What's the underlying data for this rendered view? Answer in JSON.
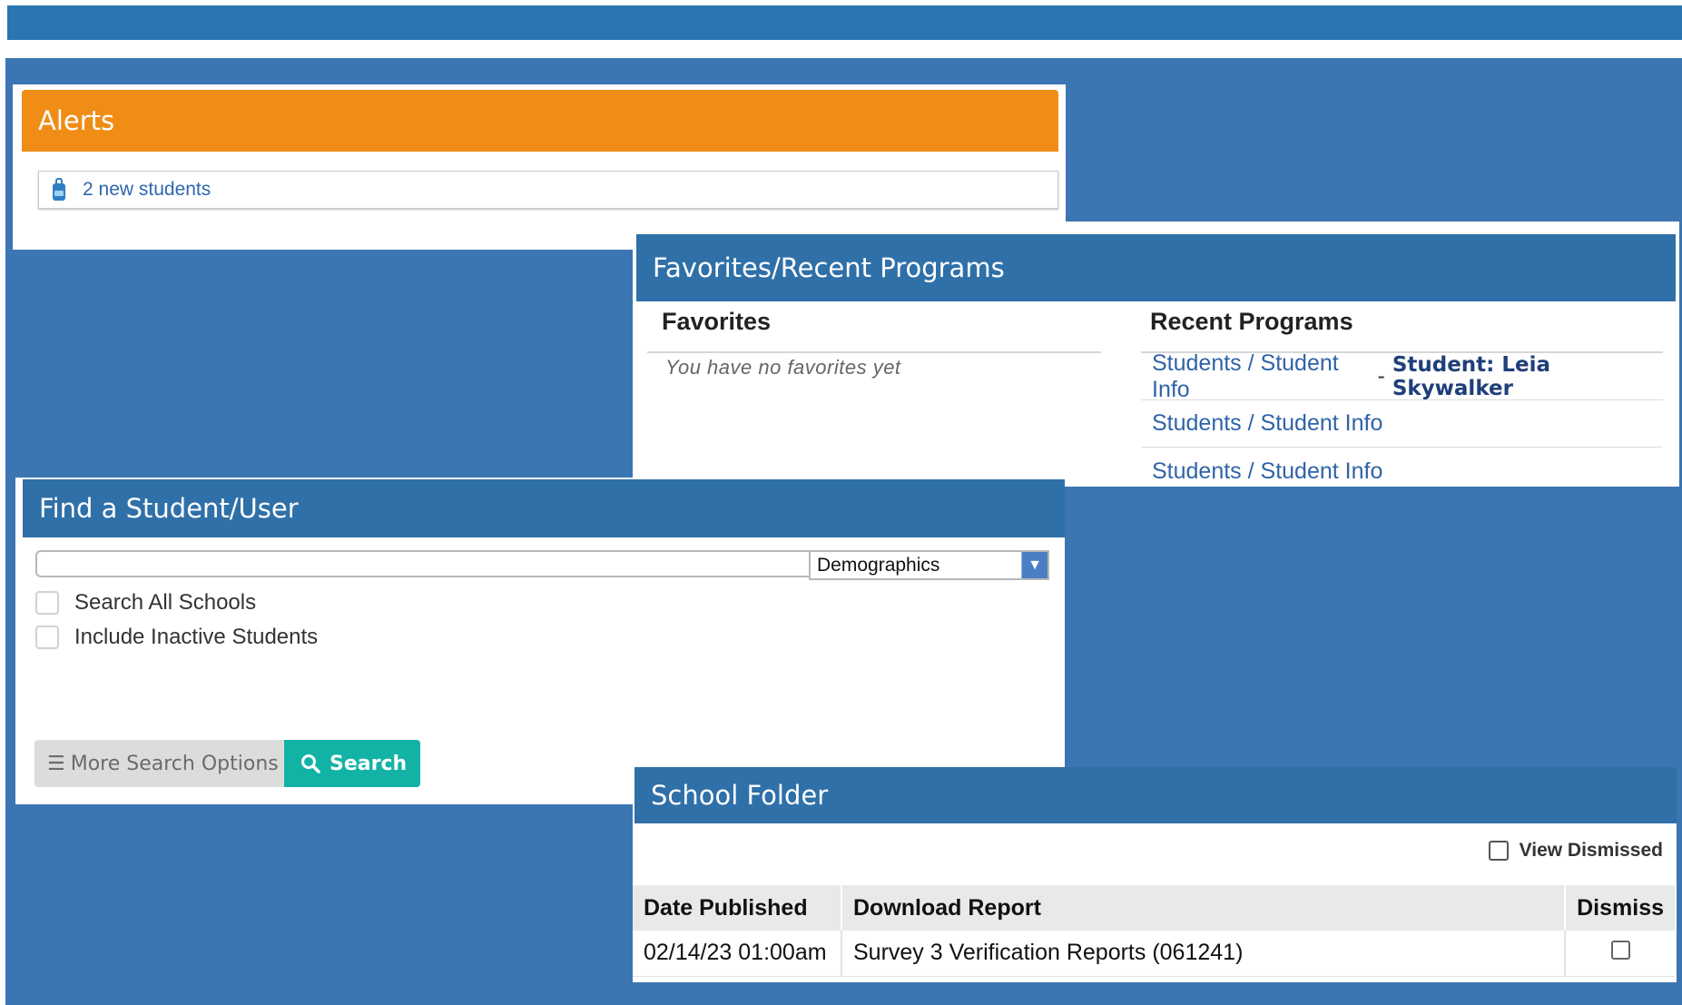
{
  "alerts": {
    "title": "Alerts",
    "items": [
      {
        "label": "2 new students",
        "icon": "backpack-icon"
      }
    ]
  },
  "favorites_panel": {
    "title": "Favorites/Recent Programs",
    "favorites_heading": "Favorites",
    "favorites_empty": "You have no favorites yet",
    "recent_heading": "Recent Programs",
    "recent": [
      {
        "path": "Students / Student Info",
        "sep": "-",
        "context": "Student: Leia Skywalker"
      },
      {
        "path": "Students / Student Info"
      },
      {
        "path": "Students / Student Info"
      }
    ]
  },
  "find": {
    "title": "Find a Student/User",
    "search_value": "",
    "select_value": "Demographics",
    "checkboxes": [
      {
        "label": "Search All Schools",
        "checked": false
      },
      {
        "label": "Include Inactive Students",
        "checked": false
      }
    ],
    "more_label": "More Search Options",
    "search_label": "Search"
  },
  "folder": {
    "title": "School Folder",
    "view_dismissed": "View Dismissed",
    "columns": [
      "Date Published",
      "Download Report",
      "Dismiss"
    ],
    "rows": [
      {
        "date": "02/14/23 01:00am",
        "report": "Survey 3 Verification Reports (061241)",
        "dismissed": false
      }
    ]
  },
  "colors": {
    "header_blue": "#2f70a8",
    "alerts_orange": "#ef8d16",
    "search_teal": "#12b3a5",
    "background": "#3b75b2"
  }
}
